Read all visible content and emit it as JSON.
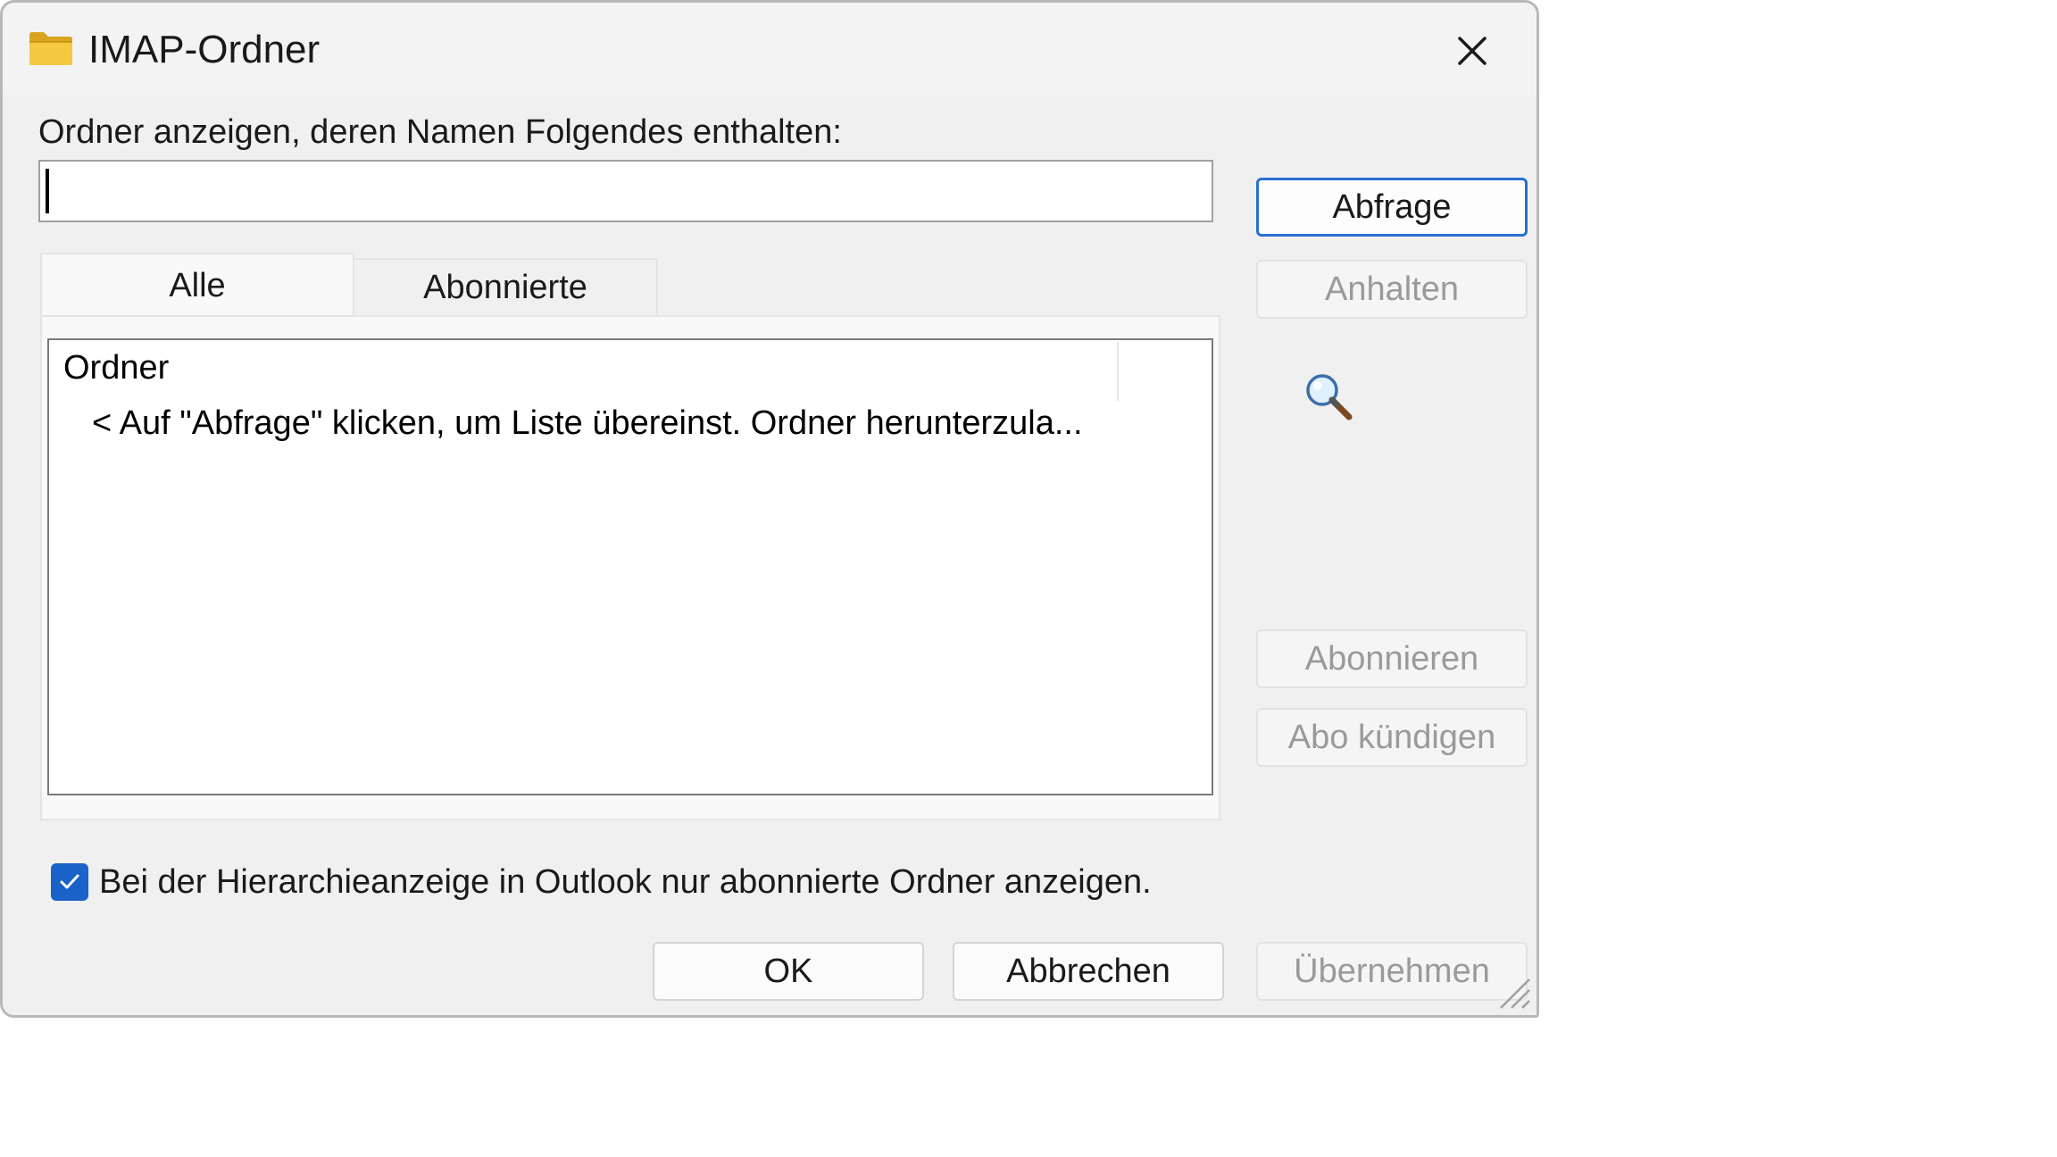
{
  "window": {
    "title": "IMAP-Ordner",
    "title_icon": "folder-icon",
    "close_icon": "close-icon"
  },
  "filter": {
    "label": "Ordner anzeigen, deren Namen Folgendes enthalten:",
    "value": "",
    "placeholder": ""
  },
  "buttons": {
    "query": "Abfrage",
    "stop": "Anhalten",
    "subscribe": "Abonnieren",
    "unsubscribe": "Abo kündigen",
    "ok": "OK",
    "cancel": "Abbrechen",
    "apply": "Übernehmen"
  },
  "tabs": [
    {
      "label": "Alle",
      "active": true
    },
    {
      "label": "Abonnierte",
      "active": false
    }
  ],
  "list": {
    "column_header": "Ordner",
    "items": [
      "< Auf \"Abfrage\" klicken, um Liste übereinst. Ordner herunterzula..."
    ]
  },
  "status_icon": "search-icon",
  "option": {
    "checked": true,
    "label": "Bei der Hierarchieanzeige in Outlook nur abonnierte Ordner anzeigen."
  },
  "colors": {
    "accent": "#1a62c8",
    "primary_border": "#2a6fd1",
    "disabled_text": "#9a9a9a"
  }
}
